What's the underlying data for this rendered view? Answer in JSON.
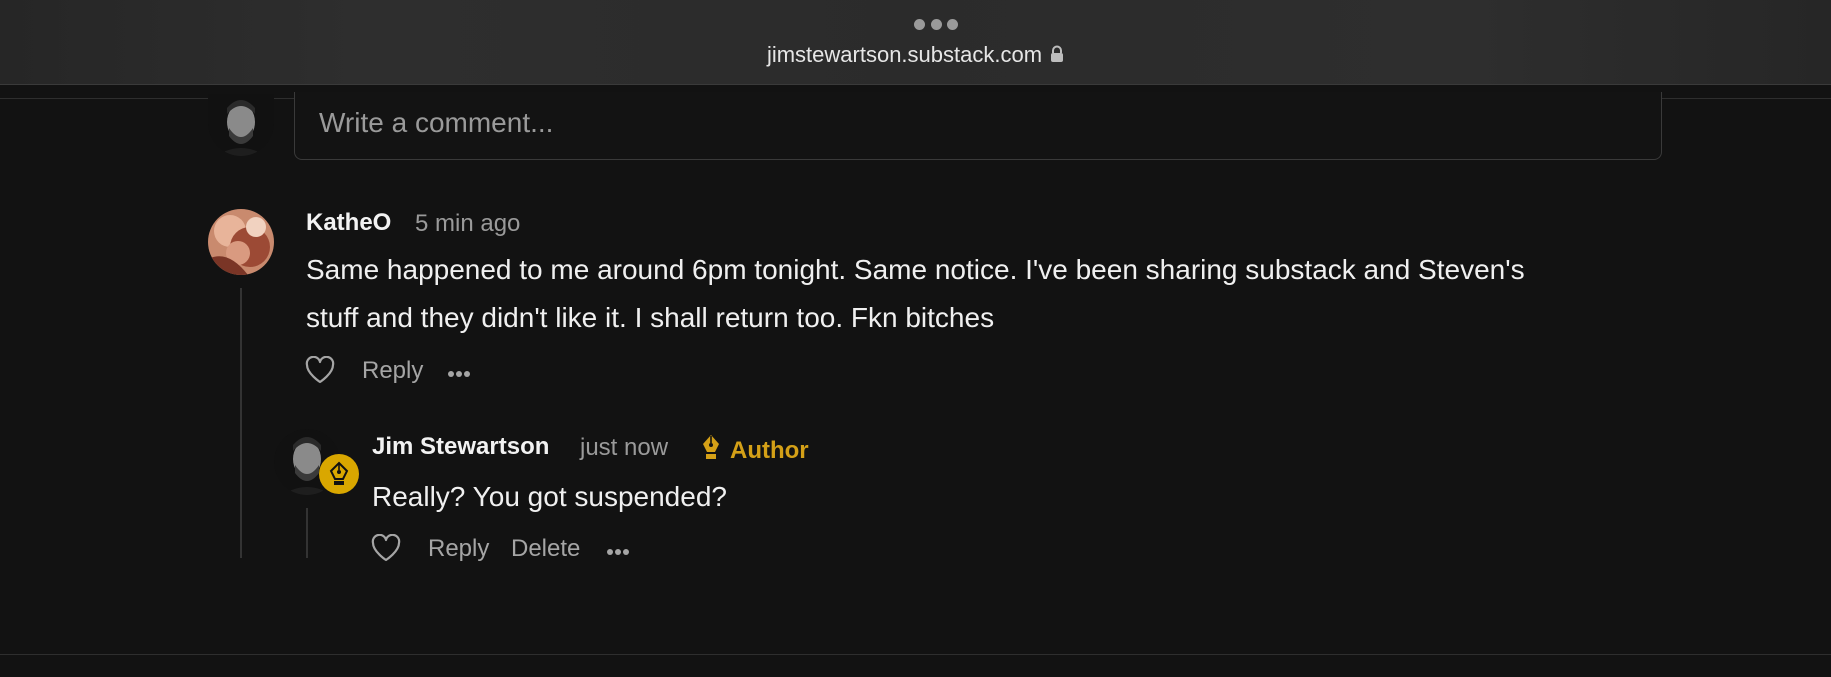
{
  "browser": {
    "url": "jimstewartson.substack.com",
    "lock_icon": "lock-icon",
    "menu_icon": "more-dots-icon"
  },
  "compose": {
    "placeholder": "Write a comment..."
  },
  "comments": [
    {
      "author": "KatheO",
      "time": "5 min ago",
      "body_line1": "Same happened to me around 6pm tonight. Same notice. I've been sharing substack and Steven's",
      "body_line2": "stuff and they didn't like it. I shall return too. Fkn bitches",
      "actions": {
        "reply": "Reply"
      },
      "replies": [
        {
          "author": "Jim Stewartson",
          "time": "just now",
          "badge": "Author",
          "body": "Really? You got suspended?",
          "actions": {
            "reply": "Reply",
            "delete": "Delete"
          }
        }
      ]
    }
  ],
  "colors": {
    "background": "#121212",
    "author_accent": "#d4a017",
    "muted_text": "#9a9a9a"
  }
}
